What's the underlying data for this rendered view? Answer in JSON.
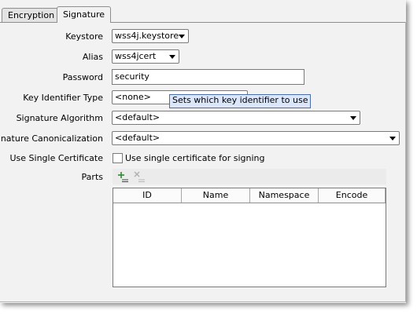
{
  "tabs": [
    {
      "label": "Encryption",
      "active": false
    },
    {
      "label": "Signature",
      "active": true
    }
  ],
  "form": {
    "keystore": {
      "label": "Keystore",
      "value": "wss4j.keystore"
    },
    "alias": {
      "label": "Alias",
      "value": "wss4jcert"
    },
    "password": {
      "label": "Password",
      "value": "security"
    },
    "key_identifier_type": {
      "label": "Key Identifier Type",
      "value": "<none>"
    },
    "signature_algorithm": {
      "label": "Signature Algorithm",
      "value": "<default>"
    },
    "signature_canonicalization": {
      "label": "Signature Canonicalization",
      "value": "<default>"
    },
    "use_single_certificate": {
      "label": "Use Single Certificate",
      "checkbox_label": "Use single certificate for signing",
      "checked": false
    }
  },
  "tooltip": "Sets which key identifier to use",
  "parts": {
    "label": "Parts",
    "toolbar": [
      {
        "icon": "add-icon",
        "enabled": true
      },
      {
        "icon": "remove-icon",
        "enabled": false
      }
    ],
    "columns": [
      "ID",
      "Name",
      "Namespace",
      "Encode"
    ],
    "rows": []
  },
  "colors": {
    "background": "#f2f2f2",
    "tooltip_bg": "#dbe6fb",
    "tooltip_border": "#4a6ea9",
    "add_icon_green": "#2e8b2e"
  }
}
